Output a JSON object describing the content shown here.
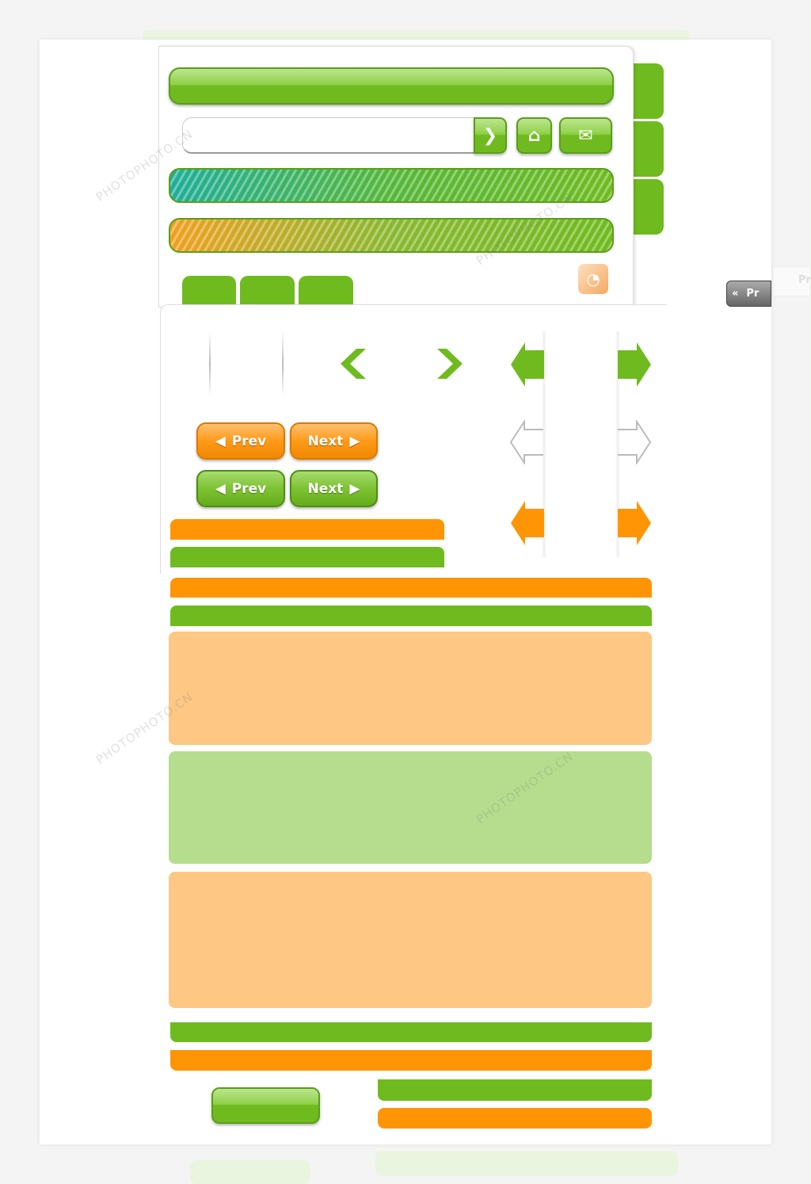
{
  "buttons": {
    "prev_label": "Prev",
    "next_label": "Next",
    "side_label": "Pr",
    "side_label_ghost": "Pr"
  },
  "icons": [
    "arrow-right-icon",
    "home-icon",
    "mail-icon",
    "rss-icon",
    "chevron-left-icon",
    "chevron-right-icon",
    "double-chevron-left-icon"
  ],
  "colors": {
    "green": "#6fbb1f",
    "orange": "#ff9505",
    "peach": "#fec783",
    "light_green": "#b5dd8d",
    "teal": "#1fae9a"
  },
  "watermark": "PHOTOPHOTO.CN"
}
